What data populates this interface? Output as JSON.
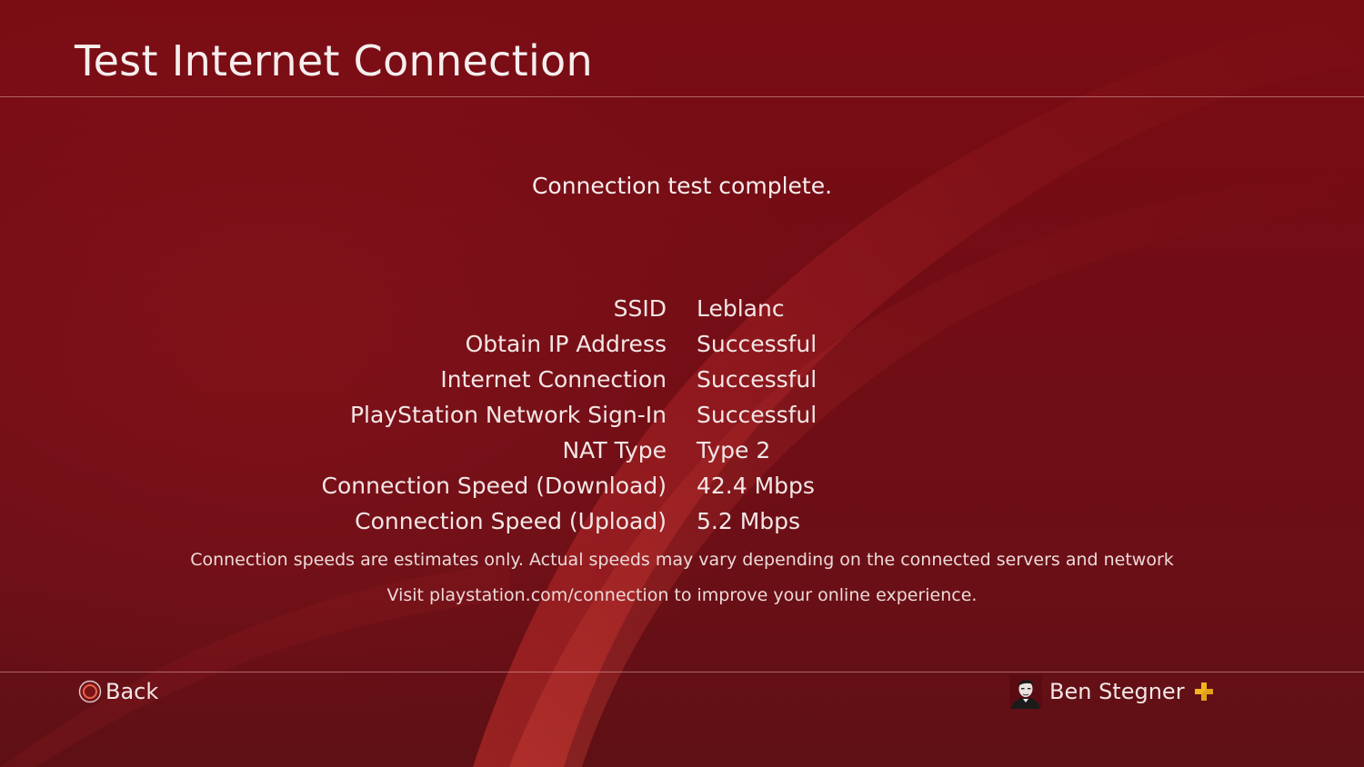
{
  "screen": {
    "title": "Test Internet Connection",
    "status": "Connection test complete."
  },
  "results": [
    {
      "label": "SSID",
      "value": "Leblanc"
    },
    {
      "label": "Obtain IP Address",
      "value": "Successful"
    },
    {
      "label": "Internet Connection",
      "value": "Successful"
    },
    {
      "label": "PlayStation Network Sign-In",
      "value": "Successful"
    },
    {
      "label": "NAT Type",
      "value": "Type 2"
    },
    {
      "label": "Connection Speed (Download)",
      "value": "42.4 Mbps"
    },
    {
      "label": "Connection Speed (Upload)",
      "value": "5.2 Mbps"
    }
  ],
  "notes": {
    "disclaimer": "Connection speeds are estimates only. Actual speeds may vary depending on the connected servers and network",
    "help": "Visit playstation.com/connection to improve your online experience."
  },
  "footer": {
    "back_label": "Back",
    "back_icon": "circle-button-icon",
    "user_name": "Ben Stegner",
    "user_avatar_icon": "avatar-icon",
    "membership_icon": "playstation-plus-icon"
  },
  "colors": {
    "background": "#6a0e14",
    "text": "#f3e6e6",
    "plus_gold": "#f2b51c",
    "circle_orange": "#e0664a"
  }
}
